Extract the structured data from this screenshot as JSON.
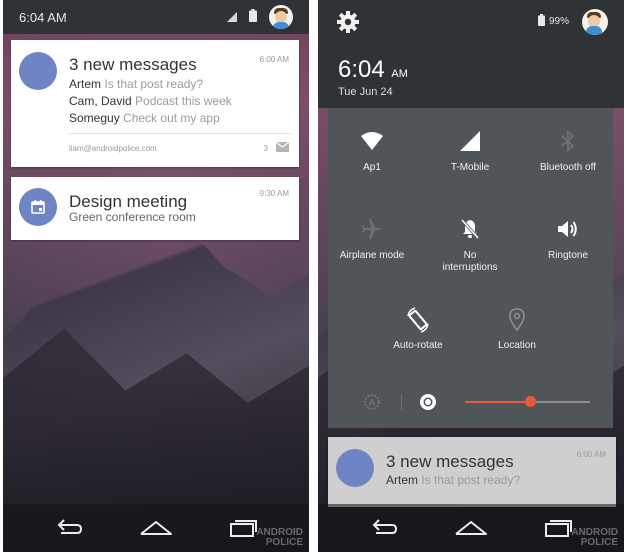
{
  "colors": {
    "accent": "#e85b3a",
    "notification_avatar": "#6f84c4",
    "panel": "#4f5558",
    "statusbar": "#2f3336"
  },
  "left": {
    "status": {
      "time": "6:04 AM",
      "icons": [
        "signal-icon",
        "battery-icon",
        "avatar"
      ]
    },
    "notifications": [
      {
        "title": "3 new messages",
        "time": "6:00 AM",
        "lines": [
          {
            "sender": "Artem",
            "text": "Is that post ready?"
          },
          {
            "sender": "Cam, David",
            "text": "Podcast this week"
          },
          {
            "sender": "Someguy",
            "text": "Check out my app"
          }
        ],
        "account": "liam@androidpolice.com",
        "count": "3",
        "icon": "envelope-icon"
      },
      {
        "title": "Design meeting",
        "time": "9:30 AM",
        "subtitle": "Green conference room",
        "icon": "calendar-icon"
      }
    ],
    "watermark": [
      "ANDROID",
      "POLICE"
    ]
  },
  "right": {
    "header": {
      "time": "6:04",
      "ampm": "AM",
      "date": "Tue Jun 24",
      "battery": "99%",
      "icons": [
        "gear-icon",
        "battery-icon",
        "avatar"
      ]
    },
    "tiles": [
      {
        "label": "Ap1",
        "icon": "wifi-icon",
        "active": true
      },
      {
        "label": "T-Mobile",
        "icon": "cell-signal-icon",
        "active": true
      },
      {
        "label": "Bluetooth off",
        "icon": "bluetooth-icon",
        "active": false
      },
      {
        "label": "Airplane mode",
        "icon": "airplane-icon",
        "active": false
      },
      {
        "label": "No interruptions",
        "icon": "bell-off-icon",
        "active": true
      },
      {
        "label": "Ringtone",
        "icon": "speaker-icon",
        "active": true
      },
      {
        "label": "Auto-rotate",
        "icon": "rotate-icon",
        "active": true
      },
      {
        "label": "Location",
        "icon": "location-pin-icon",
        "active": false
      }
    ],
    "brightness": {
      "auto": false,
      "level": 0.52
    },
    "notification": {
      "title": "3 new messages",
      "time": "6:00 AM",
      "sender": "Artem",
      "text": "Is that post ready?"
    },
    "watermark": [
      "ANDROID",
      "POLICE"
    ]
  }
}
